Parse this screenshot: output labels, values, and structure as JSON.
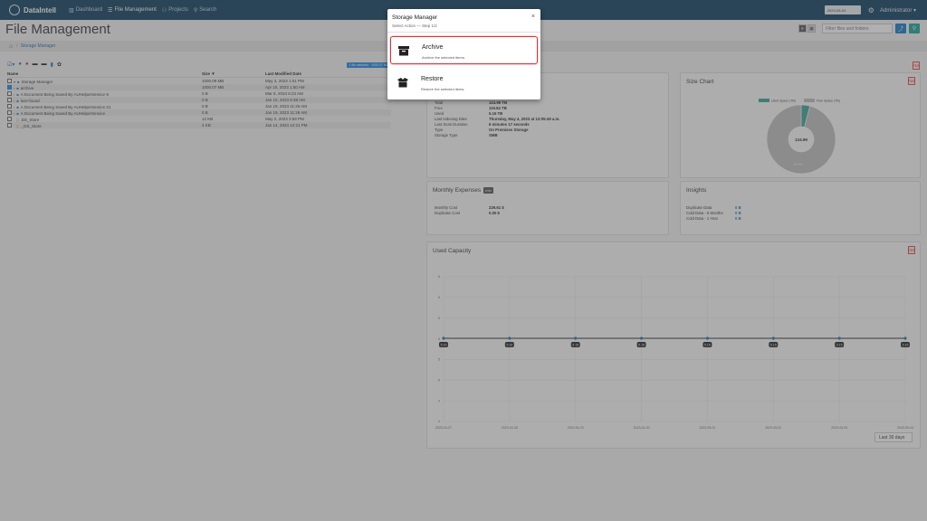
{
  "nav": {
    "brand": "DataIntell",
    "items": [
      {
        "label": "Dashboard",
        "icon": "chart-icon"
      },
      {
        "label": "File Management",
        "icon": "list-icon"
      },
      {
        "label": "Projects",
        "icon": "hierarchy-icon"
      },
      {
        "label": "Search",
        "icon": "search-icon"
      }
    ],
    "date_value": "2023-05-04",
    "user": "Administrator ▾"
  },
  "page": {
    "title": "File Management",
    "filter_placeholder": "Filter files and folders",
    "breadcrumb": "Storage Manager"
  },
  "table": {
    "selection_badge": "1 file selected · 1000.07 MB",
    "headers": {
      "name": "Name",
      "size": "Size ▼",
      "date": "Last Modified Date"
    },
    "rows": [
      {
        "name": "Storage Manager",
        "size": "1000.09 MB",
        "date": "May 3, 2023 1:01 PM"
      },
      {
        "name": "archive",
        "size": "1000.07 MB",
        "date": "Apr 10, 2023 1:50 AM"
      },
      {
        "name": "A Document Being Saved By AUHelperService 9",
        "size": "0 B",
        "date": "Mar 8, 2023 6:23 AM"
      },
      {
        "name": "lost+found",
        "size": "0 B",
        "date": "Jan 10, 2023 8:38 AM"
      },
      {
        "name": "A Document Being Saved By AUHelperService 21",
        "size": "0 B",
        "date": "Jan 19, 2023 11:26 AM"
      },
      {
        "name": "A Document Being Saved By AUHelperService",
        "size": "0 B",
        "date": "Jan 19, 2023 11:26 AM"
      },
      {
        "name": ".DS_Store",
        "size": "12 KB",
        "date": "May 2, 2023 3:59 PM"
      },
      {
        "name": "._DS_Store",
        "size": "4 KB",
        "date": "Jan 14, 2023 12:21 PM"
      }
    ]
  },
  "details": {
    "rows": [
      {
        "k": "Total",
        "v": "124.99 TB"
      },
      {
        "k": "Free",
        "v": "119.84 TB"
      },
      {
        "k": "Used",
        "v": "5.15 TB"
      },
      {
        "k": "Last Indexing Date",
        "v": "Thursday, May 4, 2023 at 13:05:49 a.m."
      },
      {
        "k": "Last Scan Duration",
        "v": "6 minutes 17 seconds"
      },
      {
        "k": "Type",
        "v": "On Premises Storage"
      },
      {
        "k": "Storage Type",
        "v": "SMB"
      }
    ]
  },
  "size_chart": {
    "title": "Size Chart",
    "legend_used": "Used Space (TB)",
    "legend_free": "Free Space (TB)",
    "center_label": "124.99",
    "free_label": "95.9%",
    "used_fraction": 0.041,
    "used_color": "#3aa39a",
    "free_color": "#bdbdbd"
  },
  "expenses": {
    "title": "Monthly Expenses",
    "badge": "Info",
    "rows": [
      {
        "k": "Monthly Cost",
        "v": "229.61 $"
      },
      {
        "k": "Duplicate Cost",
        "v": "0.00 $"
      }
    ]
  },
  "insights": {
    "title": "Insights",
    "rows": [
      {
        "k": "Duplicate Data",
        "v": "0 B"
      },
      {
        "k": "Cold Data - 6 Months",
        "v": "0 B"
      },
      {
        "k": "Cold Data - 1 Year",
        "v": "0 B"
      }
    ]
  },
  "chart_data": {
    "type": "line",
    "title": "Used Capacity",
    "x": [
      "2023-04-27",
      "2023-04-28",
      "2023-04-29",
      "2023-04-30",
      "2023-05-01",
      "2023-05-02",
      "2023-05-03",
      "2023-05-04"
    ],
    "series": [
      {
        "values": [
          5.15,
          5.15,
          5.15,
          5.15,
          5.15,
          5.15,
          5.15,
          5.15
        ],
        "labels": [
          "5.15",
          "5.15",
          "5.15",
          "5.15",
          "5.15",
          "5.15",
          "5.15",
          "5.15"
        ]
      }
    ],
    "y_ticks": [
      "6",
      "5",
      "5",
      "5",
      "5",
      "5",
      "4",
      "4"
    ],
    "ylim": [
      4,
      6
    ],
    "grid": true,
    "range_select": "Last 30 days"
  },
  "modal": {
    "title": "Storage Manager",
    "subtitle": "Select Action — Step 1/2",
    "close": "×",
    "options": [
      {
        "label": "Archive",
        "desc": "Archive the selected items."
      },
      {
        "label": "Restore",
        "desc": "Restore the selected items."
      }
    ]
  }
}
